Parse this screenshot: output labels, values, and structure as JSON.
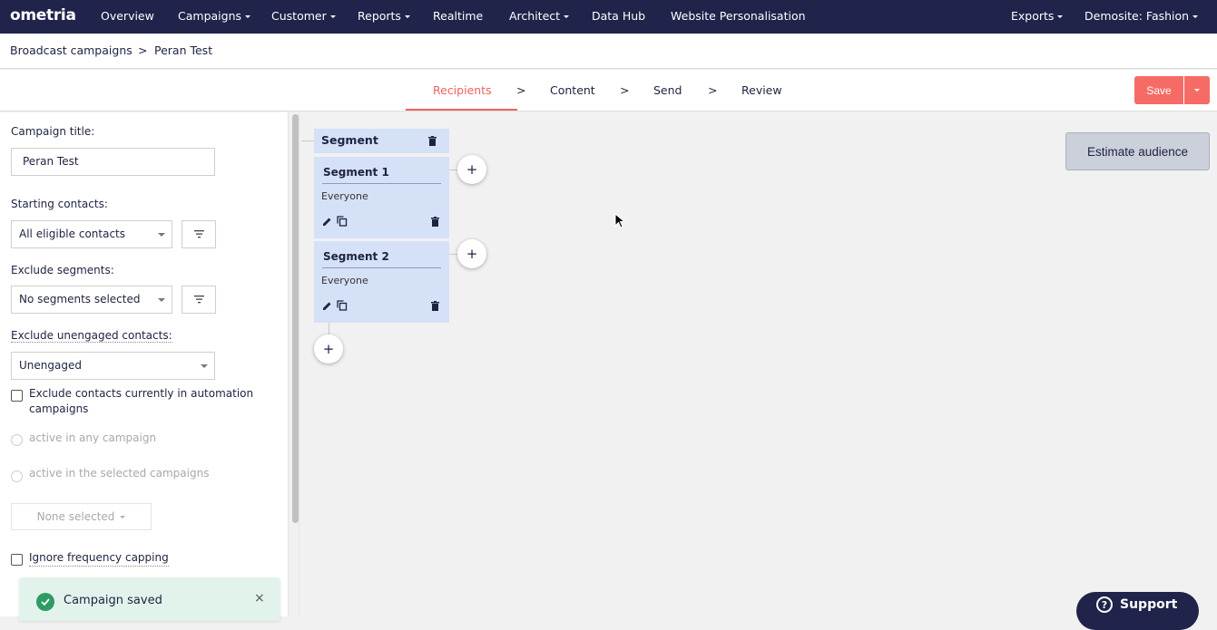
{
  "nav": {
    "logo": "ometria",
    "items": [
      {
        "label": "Overview",
        "caret": false
      },
      {
        "label": "Campaigns",
        "caret": true
      },
      {
        "label": "Customer",
        "caret": true
      },
      {
        "label": "Reports",
        "caret": true
      },
      {
        "label": "Realtime",
        "caret": false
      },
      {
        "label": "Architect",
        "caret": true
      },
      {
        "label": "Data Hub",
        "caret": false
      },
      {
        "label": "Website Personalisation",
        "caret": false
      }
    ],
    "exports": "Exports",
    "account": "Demosite: Fashion"
  },
  "breadcrumb": {
    "parent": "Broadcast campaigns",
    "separator": ">",
    "current": "Peran Test"
  },
  "steps": {
    "items": [
      "Recipients",
      "Content",
      "Send",
      "Review"
    ],
    "separator": ">",
    "active": "Recipients",
    "save_label": "Save"
  },
  "form": {
    "title_label": "Campaign title:",
    "title_value": "Peran Test",
    "starting_label": "Starting contacts:",
    "starting_value": "All eligible contacts",
    "exclude_segments_label": "Exclude segments:",
    "exclude_segments_value": "No segments selected",
    "unengaged_label": "Exclude unengaged contacts:",
    "unengaged_value": "Unengaged",
    "exclude_automation_label": "Exclude contacts currently in automation campaigns",
    "radio_any": "active in any campaign",
    "radio_selected": "active in the selected campaigns",
    "campaigns_select": "None selected",
    "ignore_capping_label": "Ignore frequency capping"
  },
  "canvas": {
    "header_title": "Segment",
    "segments": [
      {
        "name": "Segment 1",
        "description": "Everyone"
      },
      {
        "name": "Segment 2",
        "description": "Everyone"
      }
    ],
    "add_symbol": "+",
    "estimate_label": "Estimate audience"
  },
  "toast": {
    "message": "Campaign saved",
    "close": "×"
  },
  "support": {
    "label": "Support",
    "icon": "?"
  },
  "colors": {
    "nav_bg": "#20244a",
    "accent": "#f0625f",
    "segment_bg": "#d5e1f7",
    "success": "#2e9b63"
  }
}
